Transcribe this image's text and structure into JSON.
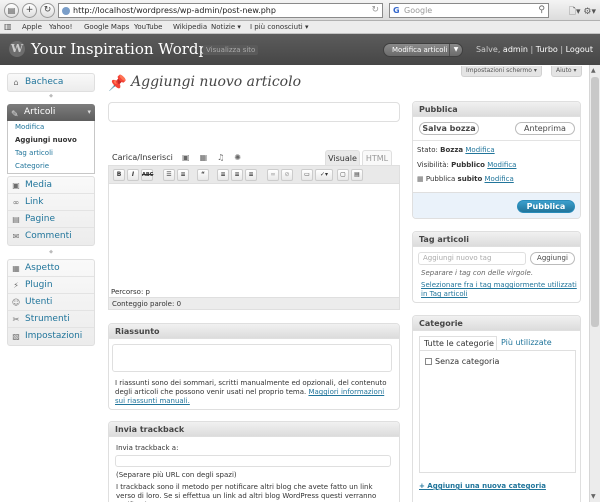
{
  "browser": {
    "url": "http://localhost/wordpress/wp-admin/post-new.php",
    "search_placeholder": "Google",
    "bookmarks": [
      "Apple",
      "Yahoo!",
      "Google Maps",
      "YouTube",
      "Wikipedia",
      "Notizie ▾",
      "I più conosciuti ▾"
    ]
  },
  "header": {
    "site_title": "Your Inspiration Wordpress",
    "view_site": "Visualizza sito",
    "favorite_actions": "Modifica articoli",
    "greeting": "Salve,",
    "username": "admin",
    "turbo": "Turbo",
    "logout": "Logout",
    "sep": "|"
  },
  "screen_options": "Impostazioni schermo ▾",
  "help": "Aiuto ▾",
  "menu": {
    "bacheca": "Bacheca",
    "articoli": "Articoli",
    "submenu": [
      "Modifica",
      "Aggiungi nuovo",
      "Tag articoli",
      "Categorie"
    ],
    "group2": [
      "Media",
      "Link",
      "Pagine",
      "Commenti"
    ],
    "group3": [
      "Aspetto",
      "Plugin",
      "Utenti",
      "Strumenti",
      "Impostazioni"
    ]
  },
  "page": {
    "title": "Aggiungi nuovo articolo"
  },
  "editor": {
    "upload_label": "Carica/Inserisci",
    "tab_visual": "Visuale",
    "tab_html": "HTML",
    "path": "Percorso: p",
    "word_count": "Conteggio parole: 0"
  },
  "excerpt": {
    "title": "Riassunto",
    "help": "I riassunti sono dei sommari, scritti manualmente ed opzionali, del contenuto degli articoli che possono venir usati nel proprio tema.",
    "help_link": "Maggiori informazioni sui riassunti manuali."
  },
  "trackback": {
    "title": "Invia trackback",
    "label": "Invia trackback a:",
    "hint": "(Separare più URL con degli spazi)",
    "help": "I trackback sono il metodo per notificare altri blog che avete fatto un link verso di loro. Se si effettua un link ad altri blog WordPress questi verranno notificati"
  },
  "publish": {
    "title": "Pubblica",
    "save_draft": "Salva bozza",
    "preview": "Anteprima",
    "status_label": "Stato:",
    "status_value": "Bozza",
    "visibility_label": "Visibilità:",
    "visibility_value": "Pubblico",
    "publish_label": "Pubblica",
    "publish_value": "subito",
    "edit": "Modifica",
    "publish_button": "Pubblica"
  },
  "tags": {
    "title": "Tag articoli",
    "placeholder": "Aggiungi nuovo tag",
    "add_button": "Aggiungi",
    "hint": "Separare i tag con delle virgole.",
    "choose_link": "Selezionare fra i tag maggiormente utilizzati in Tag articoli"
  },
  "categories": {
    "title": "Categorie",
    "tab_all": "Tutte le categorie",
    "tab_popular": "Più utilizzate",
    "items": [
      "Senza categoria"
    ],
    "add_link": "+ Aggiungi una nuova categoria"
  },
  "colors": {
    "link": "#21759b",
    "header": "#464646",
    "primary": "#21759b"
  }
}
